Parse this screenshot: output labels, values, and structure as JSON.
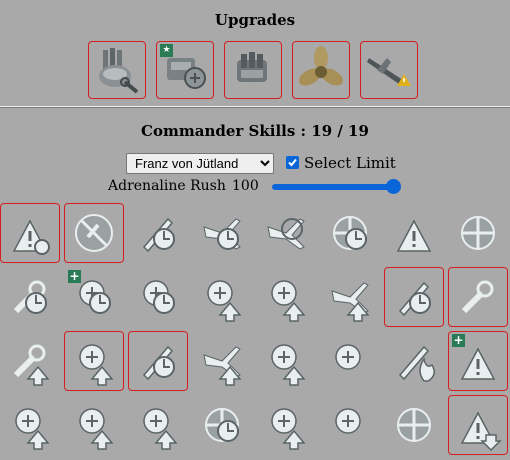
{
  "upgrades": {
    "title": "Upgrades",
    "slots": [
      {
        "icon": "main-battery-mod-icon"
      },
      {
        "icon": "special-upgrade-icon"
      },
      {
        "icon": "turret-upgrade-icon"
      },
      {
        "icon": "propeller-icon"
      },
      {
        "icon": "aircraft-warning-icon"
      }
    ]
  },
  "commander": {
    "title": "Commander Skills : 19 / 19",
    "selected_commander": "Franz von Jütland",
    "select_limit_label": "Select Limit",
    "select_limit_checked": true,
    "adrenaline_label": "Adrenaline Rush",
    "adrenaline_value": "100",
    "adrenaline_fraction": 0.98
  },
  "skills": [
    {
      "icon": "warning-triangle-icon",
      "selected": true
    },
    {
      "icon": "no-target-icon",
      "selected": true
    },
    {
      "icon": "torpedo-timer-icon",
      "selected": false
    },
    {
      "icon": "aircraft-timer-icon",
      "selected": false
    },
    {
      "icon": "aircraft-target-icon",
      "selected": false
    },
    {
      "icon": "aa-gun-timer-icon",
      "selected": false
    },
    {
      "icon": "torpedo-warning-icon",
      "selected": false
    },
    {
      "icon": "fan-shield-icon",
      "selected": false
    },
    {
      "icon": "wrench-timer-icon",
      "selected": false
    },
    {
      "icon": "stopwatch-plus-icon",
      "selected": false,
      "badge": "+"
    },
    {
      "icon": "gun-timer-icon",
      "selected": false
    },
    {
      "icon": "arrow-up-right-icon",
      "selected": false
    },
    {
      "icon": "fire-grid-up-icon",
      "selected": false
    },
    {
      "icon": "aircraft-up-icon",
      "selected": false
    },
    {
      "icon": "torpedo-pair-timer-icon",
      "selected": true
    },
    {
      "icon": "gears-wrench-icon",
      "selected": true
    },
    {
      "icon": "wrench-up-icon",
      "selected": false
    },
    {
      "icon": "ship-up-icon",
      "selected": true
    },
    {
      "icon": "missile-timer-icon",
      "selected": true
    },
    {
      "icon": "aircraft-grid-up-icon",
      "selected": false
    },
    {
      "icon": "plus-shells-up-icon",
      "selected": false
    },
    {
      "icon": "plus-ammo-icon",
      "selected": false
    },
    {
      "icon": "torpedo-fire-icon",
      "selected": false
    },
    {
      "icon": "missile-warning-plus-icon",
      "selected": true,
      "badge": "+"
    },
    {
      "icon": "shells-up-icon",
      "selected": false
    },
    {
      "icon": "extinguisher-up-icon",
      "selected": false
    },
    {
      "icon": "crossed-guns-up-icon",
      "selected": false
    },
    {
      "icon": "radar-timer-icon",
      "selected": false
    },
    {
      "icon": "crosshair-up-icon",
      "selected": false
    },
    {
      "icon": "crosshair-target-icon",
      "selected": false
    },
    {
      "icon": "compass-icon",
      "selected": false
    },
    {
      "icon": "warning-down-icon",
      "selected": true
    }
  ]
}
